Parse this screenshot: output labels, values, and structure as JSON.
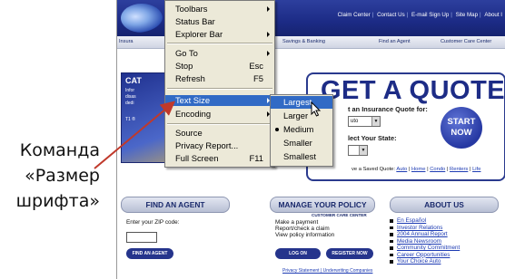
{
  "caption": {
    "lines": [
      "Команда",
      "«Размер",
      "шрифта»"
    ]
  },
  "site": {
    "top_links": [
      "Claim Center",
      "Contact Us",
      "E-mail Sign Up",
      "Site Map",
      "About I"
    ],
    "nav": [
      "Insura",
      "Savings & Banking",
      "Find an Agent",
      "Customer Care Center"
    ],
    "cat": {
      "title": "CAT",
      "lines": [
        "Infor",
        "disas",
        "dedi",
        "T1 ®"
      ]
    },
    "quote": {
      "title": "GET A QUOTE",
      "line1": "t an Insurance Quote for:",
      "select1": "uto",
      "line2": "lect Your State:",
      "start": [
        "START",
        "NOW"
      ],
      "retrieve_label": "ve a Saved Quote:",
      "retrieve_links": [
        "Auto",
        "Home",
        "Condo",
        "Renters",
        "Life"
      ]
    },
    "find_agent": {
      "heading": "FIND AN AGENT",
      "zip_label": "Enter your ZIP code:",
      "button": "FIND AN AGENT"
    },
    "manage_policy": {
      "heading": "MANAGE YOUR POLICY",
      "sub": "CUSTOMER CARE CENTER",
      "lines": [
        "Make a payment",
        "Report/check a claim",
        "View policy information"
      ],
      "login": "LOG ON",
      "register": "REGISTER NOW"
    },
    "about_us": {
      "heading": "ABOUT US",
      "items": [
        "En Español",
        "Investor Relations",
        "2004 Annual Report",
        "Media Newsroom",
        "Community Commitment",
        "Career Opportunities",
        "Your Choice Auto"
      ]
    },
    "footer": "Privacy Statement | Underwriting Companies"
  },
  "view_menu": {
    "items": [
      {
        "label": "Toolbars",
        "submenu": true
      },
      {
        "label": "Status Bar"
      },
      {
        "label": "Explorer Bar",
        "submenu": true
      },
      {
        "label": "Go To",
        "submenu": true
      },
      {
        "label": "Stop",
        "shortcut": "Esc"
      },
      {
        "label": "Refresh",
        "shortcut": "F5"
      },
      {
        "label": "Text Size",
        "submenu": true,
        "highlighted": true
      },
      {
        "label": "Encoding",
        "submenu": true
      },
      {
        "label": "Source"
      },
      {
        "label": "Privacy Report..."
      },
      {
        "label": "Full Screen",
        "shortcut": "F11"
      }
    ]
  },
  "text_size_menu": {
    "items": [
      {
        "label": "Largest",
        "highlighted": true
      },
      {
        "label": "Larger"
      },
      {
        "label": "Medium",
        "checked": true
      },
      {
        "label": "Smaller"
      },
      {
        "label": "Smallest"
      }
    ]
  },
  "colors": {
    "menu_bg": "#ece9d8",
    "highlight": "#316ac5",
    "site_blue": "#1d2c86",
    "arrow": "#c0392b"
  }
}
